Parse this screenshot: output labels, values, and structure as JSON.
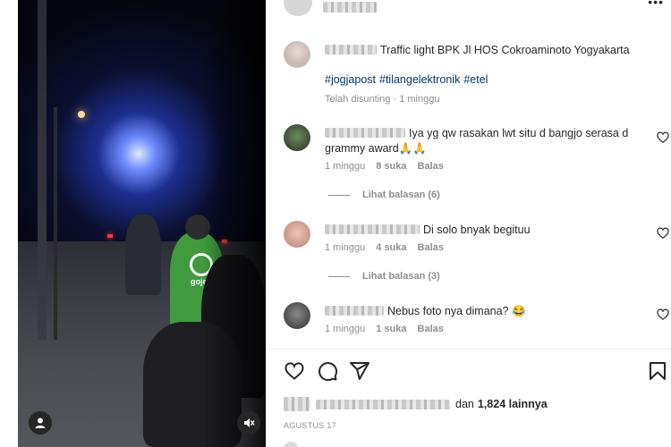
{
  "post": {
    "caption": "Traffic light BPK Jl HOS Cokroaminoto Yogyakarta",
    "hashtags": [
      "#jogjapost",
      "#tilangelektronik",
      "#etel"
    ],
    "edited": "Telah disunting",
    "separator": "·",
    "edited_time": "1 minggu"
  },
  "video": {
    "brand_logo_text": "gojek"
  },
  "comments": [
    {
      "text": "Iya yg qw rasakan lwt situ d bangjo serasa d grammy award🙏🙏",
      "time": "1 minggu",
      "likes": "8 suka",
      "reply": "Balas",
      "view_replies": "Lihat balasan (6)"
    },
    {
      "text": "Di solo bnyak begituu",
      "time": "1 minggu",
      "likes": "4 suka",
      "reply": "Balas",
      "view_replies": "Lihat balasan (3)"
    },
    {
      "text": "Nebus foto nya dimana? 😂",
      "time": "1 minggu",
      "likes": "1 suka",
      "reply": "Balas"
    }
  ],
  "likes_row": {
    "and": "dan",
    "count": "1,824 lainnya"
  },
  "date": "AGUSTUS 17",
  "icons": {
    "more": "more-icon",
    "heart": "heart-icon",
    "comment": "comment-icon",
    "share": "share-icon",
    "save": "bookmark-icon",
    "mute": "mute-icon",
    "user": "user-icon"
  }
}
